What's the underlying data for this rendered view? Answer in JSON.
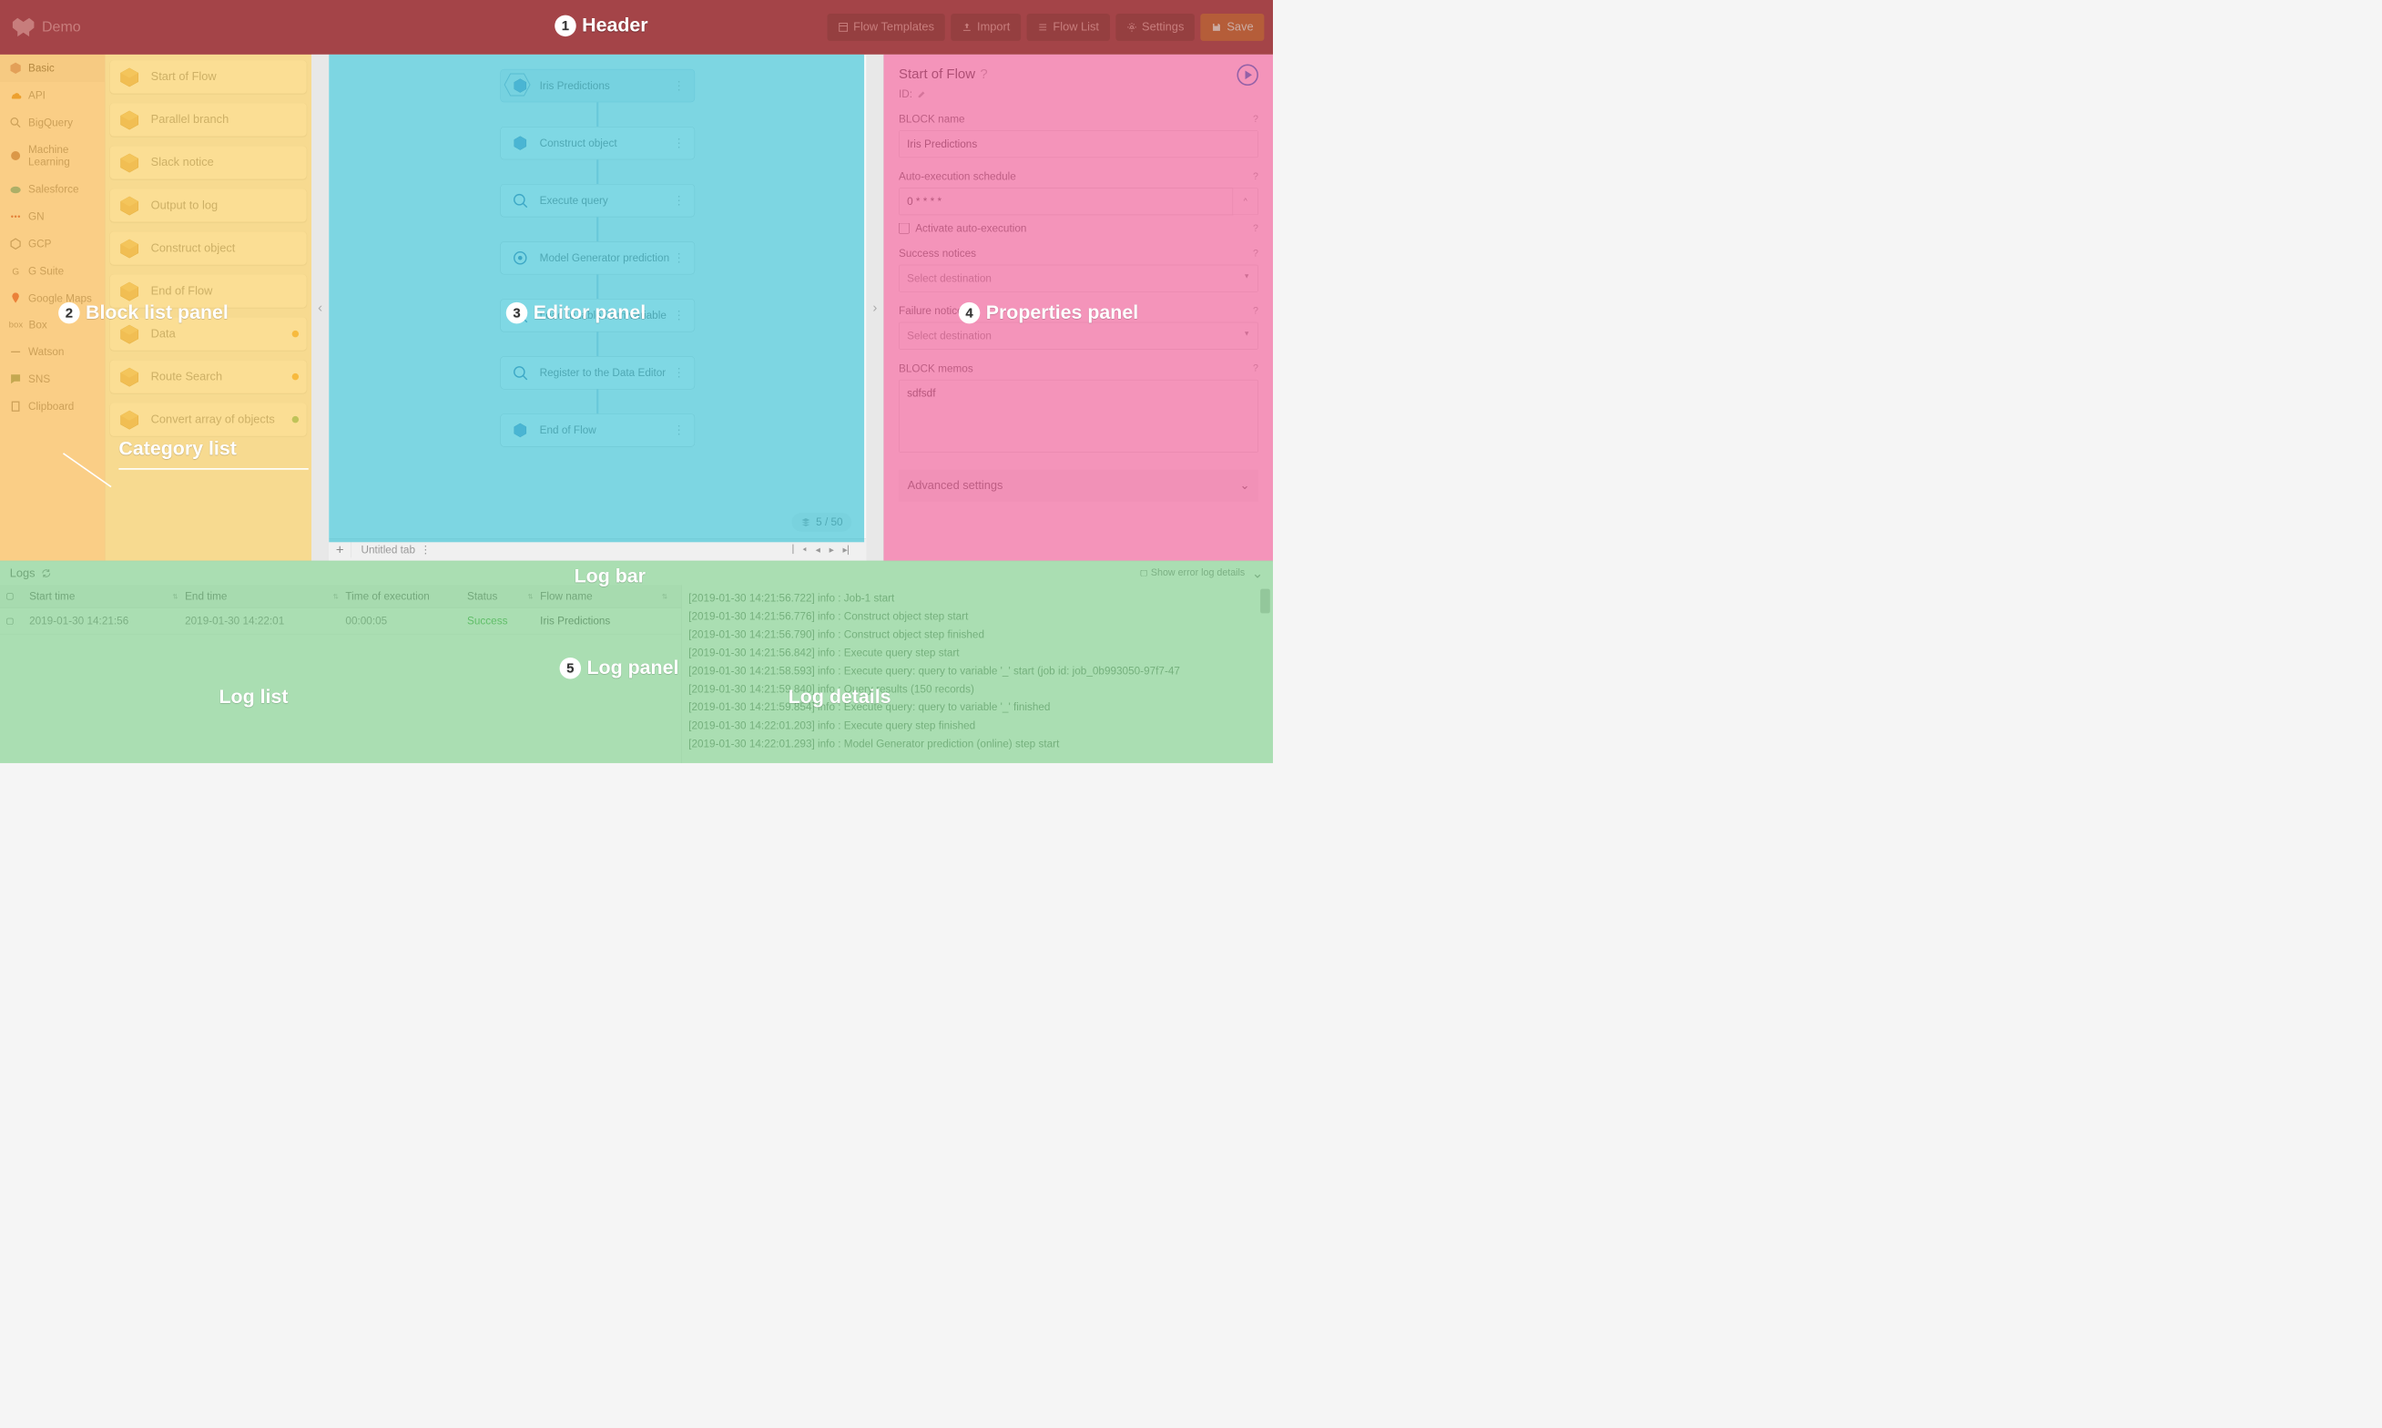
{
  "header": {
    "app_name": "Demo",
    "buttons": {
      "templates": "Flow Templates",
      "import": "Import",
      "flowlist": "Flow List",
      "settings": "Settings",
      "save": "Save"
    }
  },
  "categories": [
    {
      "label": "Basic",
      "icon": "cube"
    },
    {
      "label": "API",
      "icon": "cloud"
    },
    {
      "label": "BigQuery",
      "icon": "search"
    },
    {
      "label": "Machine Learning",
      "icon": "brain"
    },
    {
      "label": "Salesforce",
      "icon": "cloud2"
    },
    {
      "label": "GN",
      "icon": "dots"
    },
    {
      "label": "GCP",
      "icon": "hex"
    },
    {
      "label": "G Suite",
      "icon": "g"
    },
    {
      "label": "Google Maps",
      "icon": "pin"
    },
    {
      "label": "Box",
      "icon": "box"
    },
    {
      "label": "Watson",
      "icon": "line"
    },
    {
      "label": "SNS",
      "icon": "chat"
    },
    {
      "label": "Clipboard",
      "icon": "clip"
    }
  ],
  "blocks": [
    {
      "label": "Start of Flow"
    },
    {
      "label": "Parallel branch"
    },
    {
      "label": "Slack notice"
    },
    {
      "label": "Output to log"
    },
    {
      "label": "Construct object"
    },
    {
      "label": "End of Flow"
    },
    {
      "label": "Data",
      "dot": "yellow"
    },
    {
      "label": "Route Search",
      "dot": "yellow"
    },
    {
      "label": "Convert array of objects",
      "dot": "green"
    }
  ],
  "flow_nodes": [
    {
      "label": "Iris Predictions",
      "type": "start"
    },
    {
      "label": "Construct object",
      "type": "cube"
    },
    {
      "label": "Execute query",
      "type": "query"
    },
    {
      "label": "Model Generator prediction",
      "type": "gear"
    },
    {
      "label": "Load to table from variable",
      "type": "query"
    },
    {
      "label": "Register to the Data Editor",
      "type": "query"
    },
    {
      "label": "End of Flow",
      "type": "cube"
    }
  ],
  "editor": {
    "tab_name": "Untitled tab",
    "node_count": "5 / 50"
  },
  "props": {
    "title": "Start of Flow",
    "id_label": "ID:",
    "fields": {
      "block_name_label": "BLOCK name",
      "block_name_value": "Iris Predictions",
      "schedule_label": "Auto-execution schedule",
      "schedule_value": "0 * * * *",
      "activate_label": "Activate auto-execution",
      "success_label": "Success notices",
      "success_value": "Select destination",
      "failure_label": "Failure notices",
      "failure_value": "Select destination",
      "memos_label": "BLOCK memos",
      "memos_value": "sdfsdf",
      "advanced_label": "Advanced settings"
    }
  },
  "logbar": {
    "title": "Logs",
    "show_errors": "Show error log details"
  },
  "log_headers": {
    "start": "Start time",
    "end": "End time",
    "duration": "Time of execution",
    "status": "Status",
    "flow": "Flow name"
  },
  "log_rows": [
    {
      "start": "2019-01-30 14:21:56",
      "end": "2019-01-30 14:22:01",
      "duration": "00:00:05",
      "status": "Success",
      "flow": "Iris Predictions"
    }
  ],
  "log_details": [
    "[2019-01-30 14:21:56.722]  info : Job-1 start",
    "[2019-01-30 14:21:56.776]  info : Construct object step start",
    "[2019-01-30 14:21:56.790]  info : Construct object step finished",
    "[2019-01-30 14:21:56.842]  info : Execute query step start",
    "[2019-01-30 14:21:58.593]  info : Execute query: query to variable '_' start (job id: job_0b993050-97f7-47",
    "[2019-01-30 14:21:59.840]  info : Query results (150 records)",
    "[2019-01-30 14:21:59.854]  info : Execute query: query to variable '_' finished",
    "[2019-01-30 14:22:01.203]  info : Execute query step finished",
    "[2019-01-30 14:22:01.293]  info : Model Generator prediction (online) step start"
  ],
  "annotations": {
    "header": "Header",
    "block_panel": "Block list panel",
    "category": "Category list",
    "editor": "Editor panel",
    "props": "Properties panel",
    "logbar": "Log bar",
    "logpanel": "Log panel",
    "loglist": "Log list",
    "logdetails": "Log details"
  }
}
